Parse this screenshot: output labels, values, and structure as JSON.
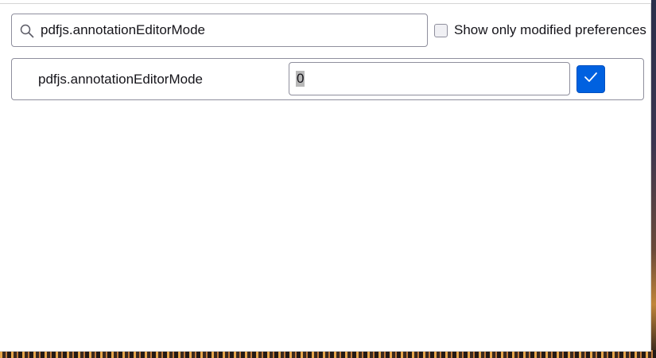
{
  "search": {
    "value": "pdfjs.annotationEditorMode",
    "icon": "search-icon"
  },
  "filter": {
    "show_modified_label": "Show only modified preferences",
    "checked": false
  },
  "preference_row": {
    "name": "pdfjs.annotationEditorMode",
    "value": "0",
    "save_icon": "checkmark-icon"
  },
  "colors": {
    "accent": "#0061e0",
    "border": "#8f8f9d",
    "text": "#15141a"
  }
}
